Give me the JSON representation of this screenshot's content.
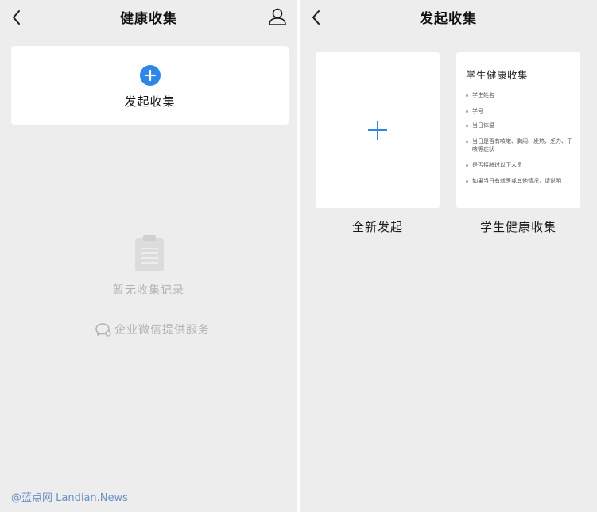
{
  "left_screen": {
    "title": "健康收集",
    "start_collect_label": "发起收集",
    "empty_text": "暂无收集记录",
    "provider_text": "企业微信提供服务"
  },
  "right_screen": {
    "title": "发起收集",
    "new_card_label": "全新发起",
    "template_card": {
      "title": "学生健康收集",
      "items": [
        "学生姓名",
        "学号",
        "当日体温",
        "当日是否有咳嗽、胸闷、发热、乏力、干咳等症状",
        "是否接触过以下人员",
        "如果当日有就医或其他情况，请说明"
      ]
    },
    "template_label": "学生健康收集"
  },
  "watermark": "@蓝点网 Landian.News",
  "colors": {
    "accent": "#2e86e6",
    "background": "#ededed",
    "card": "#ffffff",
    "muted_text": "#b2b2b2"
  },
  "icons": {
    "back": "chevron-left-icon",
    "user": "person-icon",
    "add": "plus-circle-icon",
    "empty": "clipboard-icon",
    "provider": "chat-bubble-icon"
  }
}
